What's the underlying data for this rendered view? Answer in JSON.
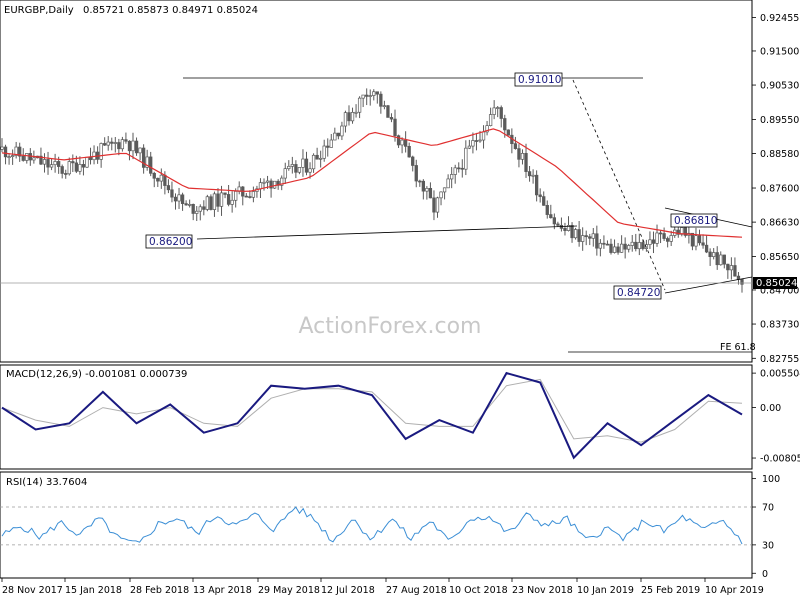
{
  "header": {
    "symbol": "EURGBP,Daily",
    "ohlc": "0.85721 0.85873 0.84971 0.85024",
    "watermark": "ActionForex.com"
  },
  "chart_data": [
    {
      "type": "candlestick",
      "panel": "price",
      "title": "EURGBP,Daily 0.85721 0.85873 0.84971 0.85024",
      "ylim": [
        0.8265,
        0.9295
      ],
      "y_ticks": [
        "0.92455",
        "0.91500",
        "0.90530",
        "0.89550",
        "0.88580",
        "0.87600",
        "0.86630",
        "0.85650",
        "0.84700",
        "0.83730",
        "0.82755"
      ],
      "current_price": "0.85024",
      "series": [
        {
          "name": "price",
          "color": "#5a5a5a",
          "x": [
            "28 Nov 2017",
            "15 Jan 2018",
            "28 Feb 2018",
            "13 Apr 2018",
            "29 May 2018",
            "12 Jul 2018",
            "27 Aug 2018",
            "10 Oct 2018",
            "23 Nov 2018",
            "10 Jan 2019",
            "25 Feb 2019",
            "10 Apr 2019",
            "Apr 2019"
          ],
          "values": [
            0.887,
            0.881,
            0.89,
            0.87,
            0.875,
            0.883,
            0.905,
            0.87,
            0.899,
            0.865,
            0.858,
            0.864,
            0.8502
          ]
        },
        {
          "name": "moving average",
          "color": "#e03030",
          "x": [
            "28 Nov 2017",
            "15 Jan 2018",
            "28 Feb 2018",
            "13 Apr 2018",
            "29 May 2018",
            "12 Jul 2018",
            "27 Aug 2018",
            "10 Oct 2018",
            "23 Nov 2018",
            "10 Jan 2019",
            "25 Feb 2019",
            "10 Apr 2019",
            "Apr 2019"
          ],
          "values": [
            0.886,
            0.884,
            0.886,
            0.876,
            0.875,
            0.879,
            0.892,
            0.888,
            0.893,
            0.882,
            0.866,
            0.863,
            0.862
          ]
        }
      ],
      "annotations": [
        {
          "label": "0.91010",
          "value": 0.9101
        },
        {
          "label": "0.86200",
          "value": 0.862
        },
        {
          "label": "0.86810",
          "value": 0.8681
        },
        {
          "label": "0.84720",
          "value": 0.8472
        },
        {
          "label": "FE 61.8",
          "value": 0.8295
        }
      ]
    },
    {
      "type": "line",
      "panel": "macd",
      "title": "MACD(12,26,9) -0.001081 0.000739",
      "ylim": [
        -0.0098,
        0.0068
      ],
      "y_ticks": [
        "0.005504",
        "0.00",
        "-0.00805"
      ],
      "series": [
        {
          "name": "MACD",
          "color": "#1a1a80",
          "values": [
            0.0,
            -0.0035,
            -0.0025,
            0.0025,
            -0.0025,
            0.0005,
            -0.004,
            -0.0025,
            0.0035,
            0.003,
            0.0035,
            0.002,
            -0.005,
            -0.002,
            -0.004,
            0.0055,
            0.004,
            -0.008,
            -0.0025,
            -0.006,
            -0.002,
            0.002,
            -0.0011
          ]
        },
        {
          "name": "Signal",
          "color": "#b0b0b0",
          "values": [
            0.0,
            -0.002,
            -0.003,
            0.0,
            -0.001,
            0.0,
            -0.0025,
            -0.003,
            0.0015,
            0.003,
            0.003,
            0.0025,
            -0.0025,
            -0.003,
            -0.003,
            0.0035,
            0.0045,
            -0.005,
            -0.0045,
            -0.0055,
            -0.0035,
            0.001,
            0.0007
          ]
        }
      ]
    },
    {
      "type": "line",
      "panel": "rsi",
      "title": "RSI(14) 33.7604",
      "ylim": [
        -5,
        107
      ],
      "y_ticks": [
        "100",
        "70",
        "30",
        "0"
      ],
      "levels": [
        70,
        30
      ],
      "series": [
        {
          "name": "RSI",
          "color": "#3c8fd6",
          "values": [
            40,
            50,
            38,
            54,
            40,
            58,
            36,
            30,
            52,
            58,
            42,
            62,
            50,
            62,
            46,
            70,
            58,
            34,
            58,
            36,
            58,
            36,
            56,
            32,
            58,
            60,
            42,
            62,
            50,
            58,
            34,
            48,
            36,
            56,
            44,
            60,
            45,
            56,
            34
          ]
        }
      ]
    }
  ],
  "x_axis": {
    "labels": [
      "28 Nov 2017",
      "15 Jan 2018",
      "28 Feb 2018",
      "13 Apr 2018",
      "29 May 2018",
      "12 Jul 2018",
      "27 Aug 2018",
      "10 Oct 2018",
      "23 Nov 2018",
      "10 Jan 2019",
      "25 Feb 2019",
      "10 Apr 2019"
    ]
  }
}
